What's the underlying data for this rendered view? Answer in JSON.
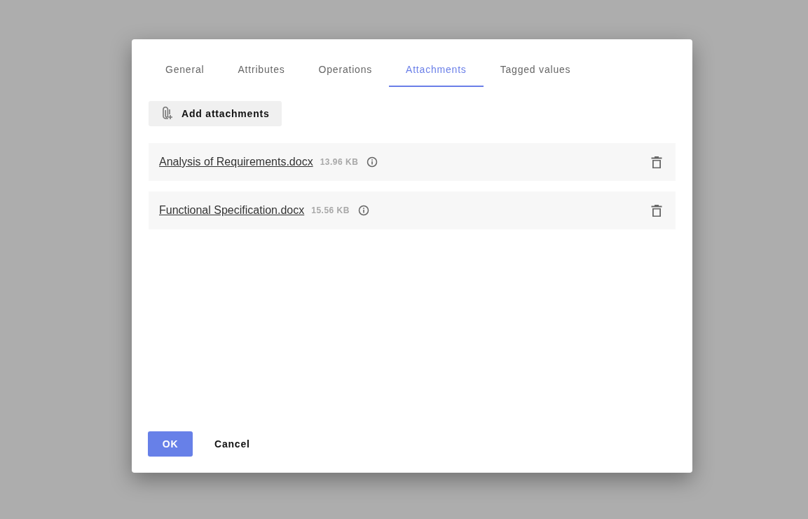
{
  "tabs": [
    {
      "label": "General",
      "selected": false
    },
    {
      "label": "Attributes",
      "selected": false
    },
    {
      "label": "Operations",
      "selected": false
    },
    {
      "label": "Attachments",
      "selected": true
    },
    {
      "label": "Tagged values",
      "selected": false
    }
  ],
  "add_button": {
    "label": "Add attachments"
  },
  "attachments": [
    {
      "name": "Analysis of Requirements.docx",
      "size": "13.96 KB"
    },
    {
      "name": "Functional Specification.docx",
      "size": "15.56 KB"
    }
  ],
  "buttons": [
    {
      "label": "OK",
      "kind": "primary"
    },
    {
      "label": "Cancel",
      "kind": "text"
    }
  ]
}
